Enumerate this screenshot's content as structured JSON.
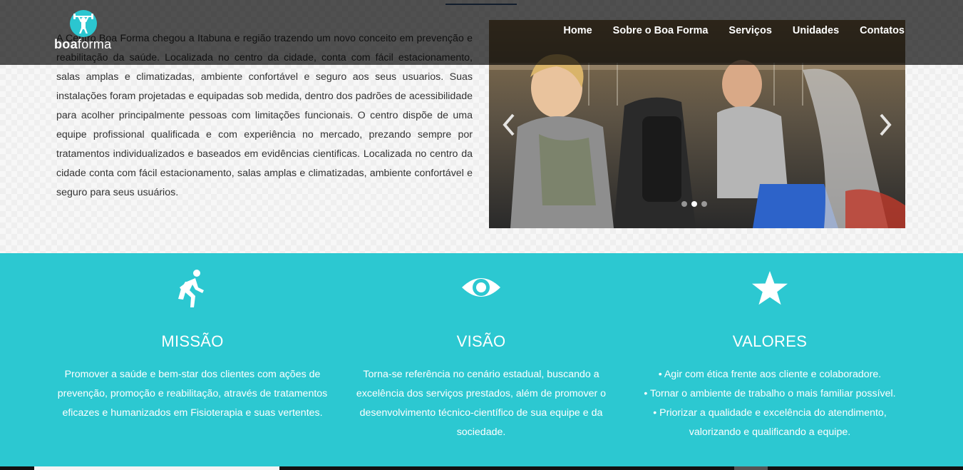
{
  "brand": {
    "name_bold": "boa",
    "name_light": "forma",
    "accent": "#2bc6d0"
  },
  "nav": {
    "items": [
      "Home",
      "Sobre o Boa Forma",
      "Serviços",
      "Unidades",
      "Contatos"
    ]
  },
  "about": {
    "text": "A Centro Boa Forma chegou a Itabuna e região trazendo um novo conceito em prevenção e reabilitação da saúde. Localizada no centro da cidade, conta com fácil estacionamento, salas amplas e climatizadas, ambiente confortável e seguro aos seus usuarios. Suas instalações foram projetadas e equipadas sob medida, dentro dos padrões de acessibilidade para acolher principalmente pessoas com limitações funcionais. O centro dispõe de uma equipe profissional qualificada e com experiência no mercado, prezando sempre por tratamentos individualizados e baseados em evidências cientificas. Localizada no centro da cidade conta com fácil estacionamento, salas amplas e climatizadas, ambiente confortável e seguro para seus usuários."
  },
  "slider": {
    "prev_icon": "chevron-left-icon",
    "next_icon": "chevron-right-icon",
    "slide_count": 3,
    "active_slide": 2
  },
  "features": [
    {
      "icon": "running-person-icon",
      "title": "MISSÃO",
      "text": "Promover a saúde e bem-star dos clientes com ações de prevenção, promoção e reabilitação, através de tratamentos eficazes e humanizados em Fisioterapia e suas vertentes."
    },
    {
      "icon": "eye-icon",
      "title": "VISÃO",
      "text": "Torna-se referência no cenário estadual, buscando a excelência dos serviços prestados, além de promover o desenvolvimento técnico-científico de sua equipe e da sociedade."
    },
    {
      "icon": "star-icon",
      "title": "VALORES",
      "lines": [
        "• Agir com ética frente aos cliente e colaboradore.",
        "• Tornar o ambiente de trabalho o mais familiar possível.",
        "• Priorizar a qualidade e excelência do atendimento, valorizando e qualificando a equipe."
      ]
    }
  ],
  "colors": {
    "band": "#2cc8d1",
    "navbar": "rgba(0,0,0,0.68)"
  }
}
